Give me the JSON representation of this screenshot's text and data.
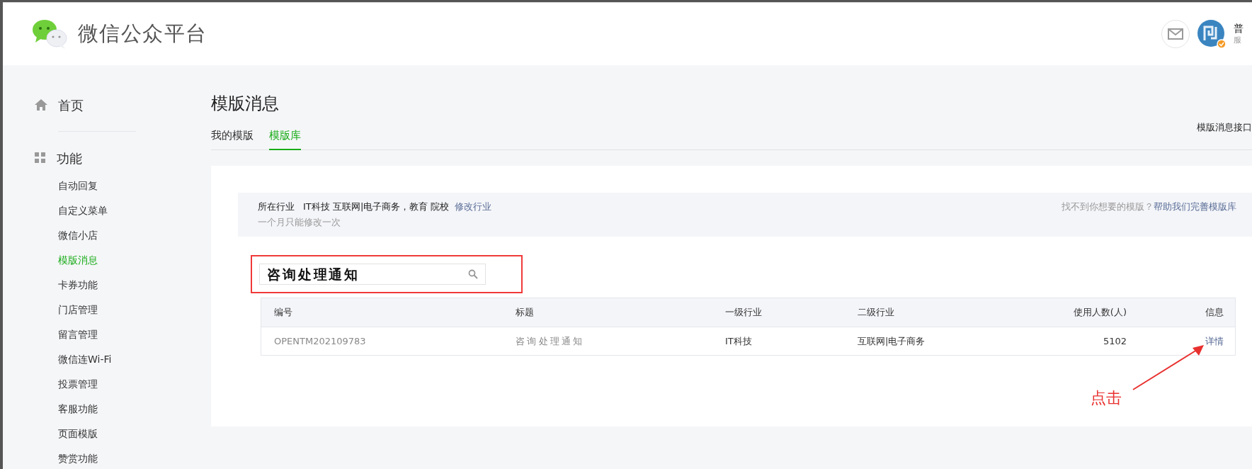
{
  "header": {
    "title": "微信公众平台",
    "user_name": "普",
    "user_role": "服"
  },
  "sidebar": {
    "home": "首页",
    "section": "功能",
    "items": [
      {
        "label": "自动回复",
        "selected": false
      },
      {
        "label": "自定义菜单",
        "selected": false
      },
      {
        "label": "微信小店",
        "selected": false
      },
      {
        "label": "模版消息",
        "selected": true
      },
      {
        "label": "卡券功能",
        "selected": false
      },
      {
        "label": "门店管理",
        "selected": false
      },
      {
        "label": "留言管理",
        "selected": false
      },
      {
        "label": "微信连Wi-Fi",
        "selected": false
      },
      {
        "label": "投票管理",
        "selected": false
      },
      {
        "label": "客服功能",
        "selected": false
      },
      {
        "label": "页面模版",
        "selected": false
      },
      {
        "label": "赞赏功能",
        "selected": false
      }
    ]
  },
  "page": {
    "title": "模版消息",
    "tabs": [
      {
        "label": "我的模版",
        "selected": false
      },
      {
        "label": "模版库",
        "selected": true
      }
    ],
    "doc_link": "模版消息接口"
  },
  "industry": {
    "label": "所在行业",
    "value": "IT科技 互联网|电子商务，教育 院校",
    "edit_link": "修改行业",
    "note": "一个月只能修改一次",
    "help_text": "找不到你想要的模版？",
    "help_link": "帮助我们完善模版库"
  },
  "search": {
    "value": "咨询处理通知"
  },
  "table": {
    "columns": [
      "编号",
      "标题",
      "一级行业",
      "二级行业",
      "使用人数(人)",
      "信息"
    ],
    "rows": [
      {
        "cells": [
          "OPENTM202109783",
          "咨询处理通知",
          "IT科技",
          "互联网|电子商务",
          "5102"
        ],
        "action": "详情"
      }
    ]
  },
  "annotation": "点击"
}
